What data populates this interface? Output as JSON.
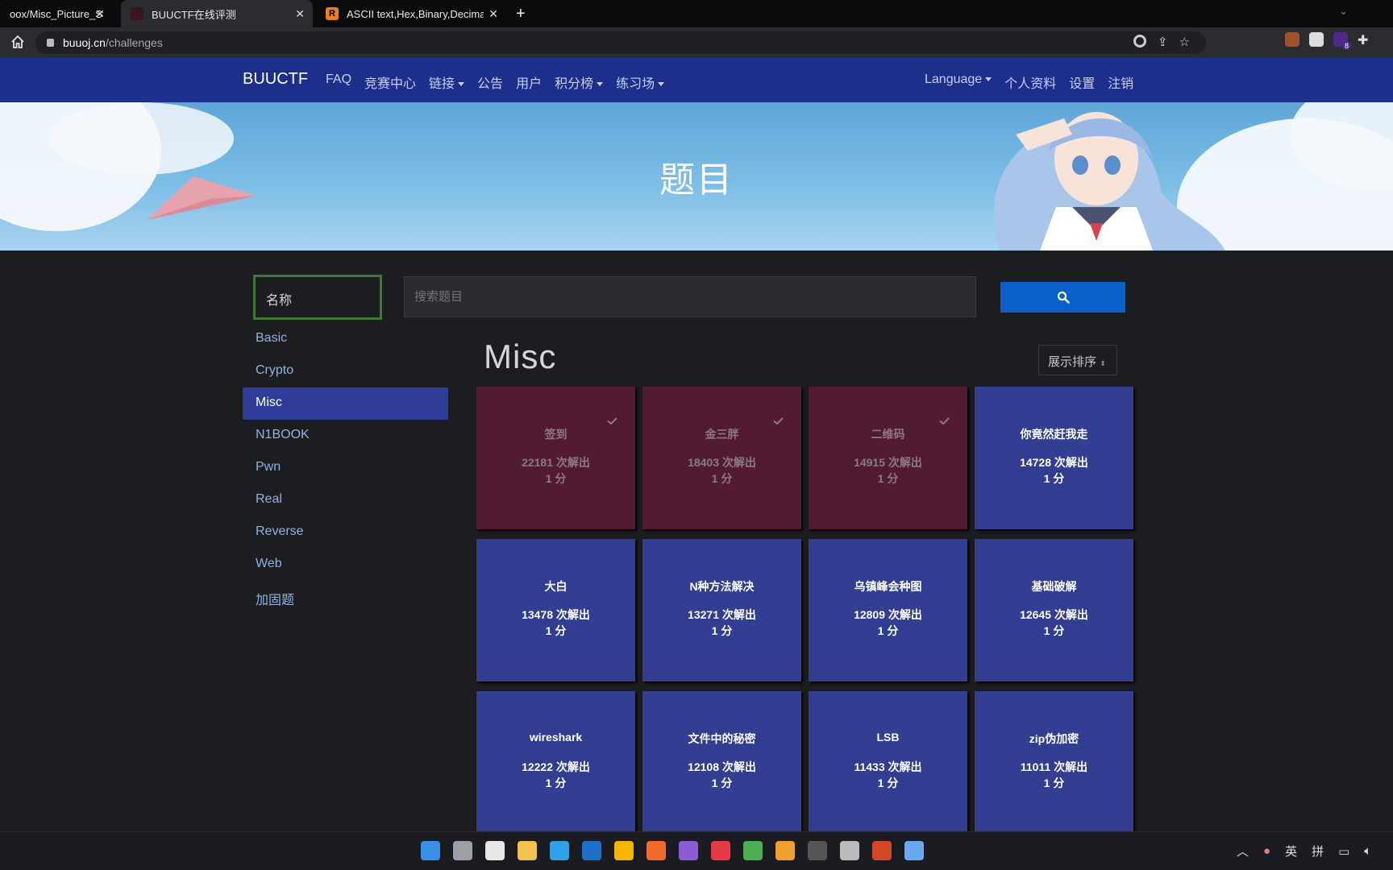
{
  "browser": {
    "tabs": [
      {
        "label": "oox/Misc_Picture_Stec",
        "active": false
      },
      {
        "label": "BUUCTF在线评测",
        "active": true
      },
      {
        "label": "ASCII text,Hex,Binary,Decimal,",
        "active": false
      }
    ],
    "new_tab_label": "+",
    "url_host": "buuoj.cn",
    "url_path": "/challenges",
    "ext_badge": "8"
  },
  "nav": {
    "brand": "BUUCTF",
    "left": [
      {
        "label": "FAQ",
        "dropdown": false
      },
      {
        "label": "竞赛中心",
        "dropdown": false
      },
      {
        "label": "链接",
        "dropdown": true
      },
      {
        "label": "公告",
        "dropdown": false
      },
      {
        "label": "用户",
        "dropdown": false
      },
      {
        "label": "积分榜",
        "dropdown": true
      },
      {
        "label": "练习场",
        "dropdown": true
      }
    ],
    "right": [
      {
        "label": "Language",
        "dropdown": true
      },
      {
        "label": "个人资料",
        "dropdown": false
      },
      {
        "label": "设置",
        "dropdown": false
      },
      {
        "label": "注销",
        "dropdown": false
      }
    ]
  },
  "banner": {
    "title": "题目"
  },
  "search": {
    "field_select": "名称",
    "placeholder": "搜索题目",
    "button_icon": "search-icon"
  },
  "categories": [
    {
      "label": "Basic",
      "active": false
    },
    {
      "label": "Crypto",
      "active": false
    },
    {
      "label": "Misc",
      "active": true
    },
    {
      "label": "N1BOOK",
      "active": false
    },
    {
      "label": "Pwn",
      "active": false
    },
    {
      "label": "Real",
      "active": false
    },
    {
      "label": "Reverse",
      "active": false
    },
    {
      "label": "Web",
      "active": false
    },
    {
      "label": "加固题",
      "active": false
    }
  ],
  "category_title": "Misc",
  "sort_label": "展示排序",
  "challenges": [
    {
      "name": "签到",
      "solves": "22181 次解出",
      "points": "1 分",
      "solved": true
    },
    {
      "name": "金三胖",
      "solves": "18403 次解出",
      "points": "1 分",
      "solved": true
    },
    {
      "name": "二维码",
      "solves": "14915 次解出",
      "points": "1 分",
      "solved": true
    },
    {
      "name": "你竟然赶我走",
      "solves": "14728 次解出",
      "points": "1 分",
      "solved": false
    },
    {
      "name": "大白",
      "solves": "13478 次解出",
      "points": "1 分",
      "solved": false
    },
    {
      "name": "N种方法解决",
      "solves": "13271 次解出",
      "points": "1 分",
      "solved": false
    },
    {
      "name": "乌镇峰会种图",
      "solves": "12809 次解出",
      "points": "1 分",
      "solved": false
    },
    {
      "name": "基础破解",
      "solves": "12645 次解出",
      "points": "1 分",
      "solved": false
    },
    {
      "name": "wireshark",
      "solves": "12222 次解出",
      "points": "1 分",
      "solved": false
    },
    {
      "name": "文件中的秘密",
      "solves": "12108 次解出",
      "points": "1 分",
      "solved": false
    },
    {
      "name": "LSB",
      "solves": "11433 次解出",
      "points": "1 分",
      "solved": false
    },
    {
      "name": "zip伪加密",
      "solves": "11011 次解出",
      "points": "1 分",
      "solved": false
    }
  ],
  "colors": {
    "navbar": "#1d2f8a",
    "solved_card": "#531b31",
    "unsolved_card": "#333e93",
    "active_category": "#2f3c98",
    "search_button": "#0b61c9"
  },
  "taskbar": {
    "apps": [
      "windows-start-icon",
      "task-view-icon",
      "store-icon",
      "file-explorer-icon",
      "edge-icon",
      "vpn-icon",
      "chrome-icon",
      "firefox-icon",
      "visual-studio-icon",
      "netease-music-icon",
      "chrome-dev-icon",
      "remote-desktop-icon",
      "obs-icon",
      "usb-drive-icon",
      "powerpoint-icon",
      "notepad-icon"
    ],
    "ime_lang": "英",
    "ime_mode": "拼"
  }
}
